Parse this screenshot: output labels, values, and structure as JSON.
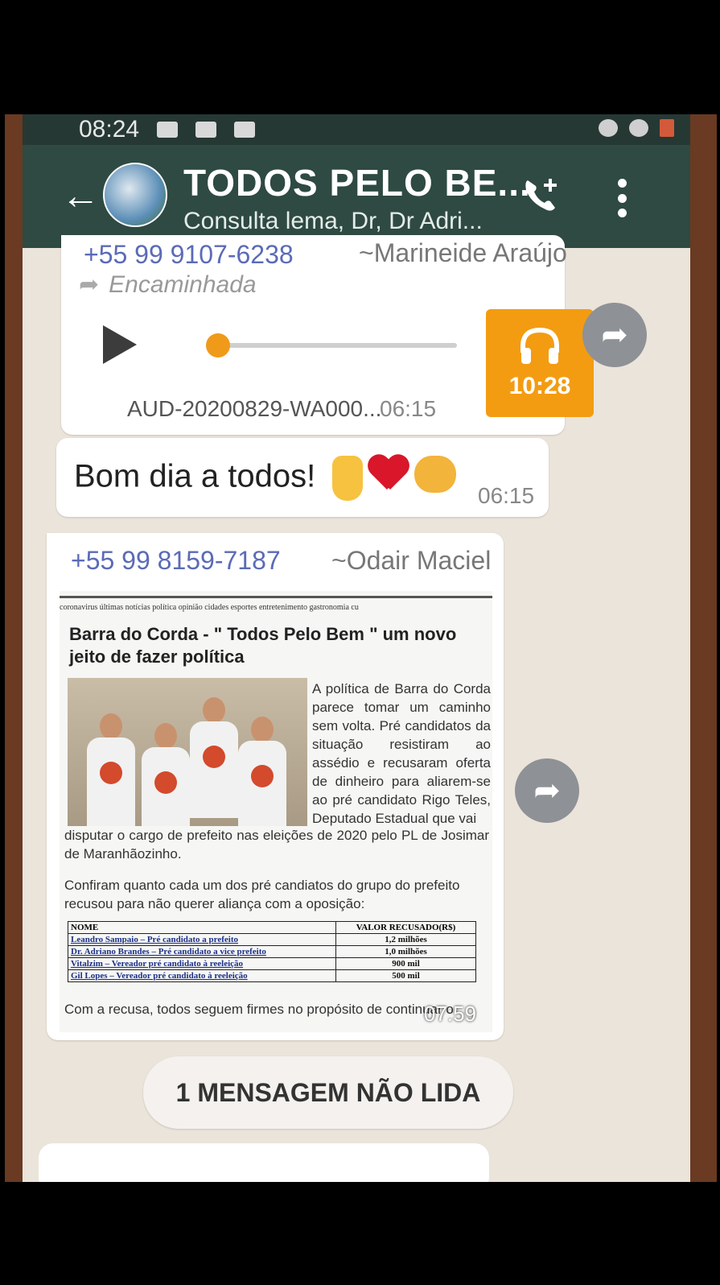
{
  "status_bar": {
    "time": "08:24"
  },
  "header": {
    "title": "TODOS PELO BE...",
    "subtitle": "Consulta lema, Dr, Dr Adri..."
  },
  "messages": [
    {
      "sender_phone": "+55 99 9107-6238",
      "sender_name": "~Marineide Araújo",
      "forwarded_label": "Encaminhada",
      "audio_file": "AUD-20200829-WA000...",
      "time": "06:15",
      "audio_duration": "10:28",
      "audio_progress": 0
    },
    {
      "text": "Bom dia a todos!",
      "emojis": [
        "victory-hand",
        "red-heart",
        "handshake"
      ],
      "time": "06:15"
    },
    {
      "sender_phone": "+55 99 8159-7187",
      "sender_name": "~Odair Maciel",
      "time": "07:59",
      "image": {
        "nav": "coronavirus   últimas notícias   política   opinião   cidades   esportes   entretenimento   gastronomia   cu",
        "headline": "Barra do Corda - \" Todos Pelo Bem \" um novo jeito de fazer política",
        "body_side": "A política de Barra do Corda parece tomar um caminho sem volta. Pré candidatos da situação resistiram ao assédio e recusaram oferta de dinheiro para aliarem-se ao pré candidato Rigo Teles, Deputado Estadual que vai",
        "body_full": "disputar o cargo de prefeito nas eleições de 2020 pelo PL de Josimar de Maranhãozinho.",
        "confirm": "Confiram quanto cada um dos pré candiatos do grupo do prefeito recusou para não querer aliança com a oposição:",
        "table_headers": [
          "NOME",
          "VALOR RECUSADO(R$)"
        ],
        "table_rows": [
          [
            "Leandro Sampaio – Pré candidato a prefeito",
            "1,2 milhões"
          ],
          [
            "Dr. Adriano Brandes – Pré candidato a vice prefeito",
            "1,0 milhões"
          ],
          [
            "Vitalzim – Vereador pré candidato à reeleição",
            "900 mil"
          ],
          [
            "Gil Lopes – Vereador pré candidato à reeleição",
            "500 mil"
          ]
        ],
        "continuation": "Com a recusa, todos seguem firmes no propósito de continuar o"
      }
    }
  ],
  "unread_banner": "1 MENSAGEM NÃO LIDA",
  "colors": {
    "header": "#2e4a42",
    "accent_audio": "#f39c12",
    "sender": "#5b6bb6",
    "chat_bg": "#ebe4da"
  }
}
